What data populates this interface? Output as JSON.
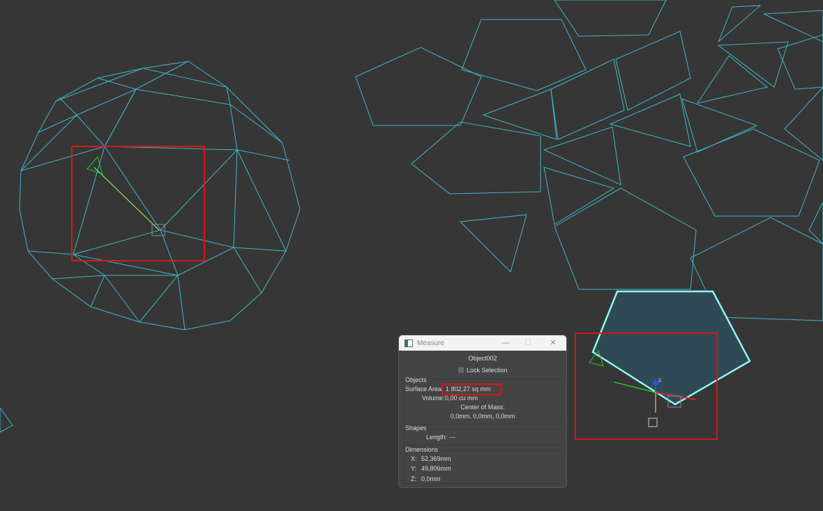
{
  "dialog": {
    "title": "Measure",
    "object_name": "Object002",
    "lock_selection_label": "Lock Selection",
    "objects_group": {
      "label": "Objects",
      "surface_area_label": "Surface Area:",
      "surface_area_value": "1 802,27 sq mm",
      "volume_label": "Volume:",
      "volume_value": "0,00 cu mm",
      "center_of_mass_label": "Center of Mass:",
      "center_of_mass_value": "0,0mm, 0,0mm, 0,0mm"
    },
    "shapes_group": {
      "label": "Shapes",
      "length_label": "Length:",
      "length_value": "---"
    },
    "dimensions_group": {
      "label": "Dimensions",
      "x_label": "X:",
      "x_value": "52,369mm",
      "y_label": "Y:",
      "y_value": "49,806mm",
      "z_label": "Z:",
      "z_value": "0,0mm"
    },
    "minimize_icon": "—",
    "maximize_icon": "☐",
    "close_icon": "✕"
  },
  "gizmo": {
    "z_axis_label": "z"
  },
  "colors": {
    "wire": "#3fb6c8",
    "highlight": "#d41818",
    "selected_fill": "#2f4a55",
    "selected_edge": "#8ff4f4"
  }
}
